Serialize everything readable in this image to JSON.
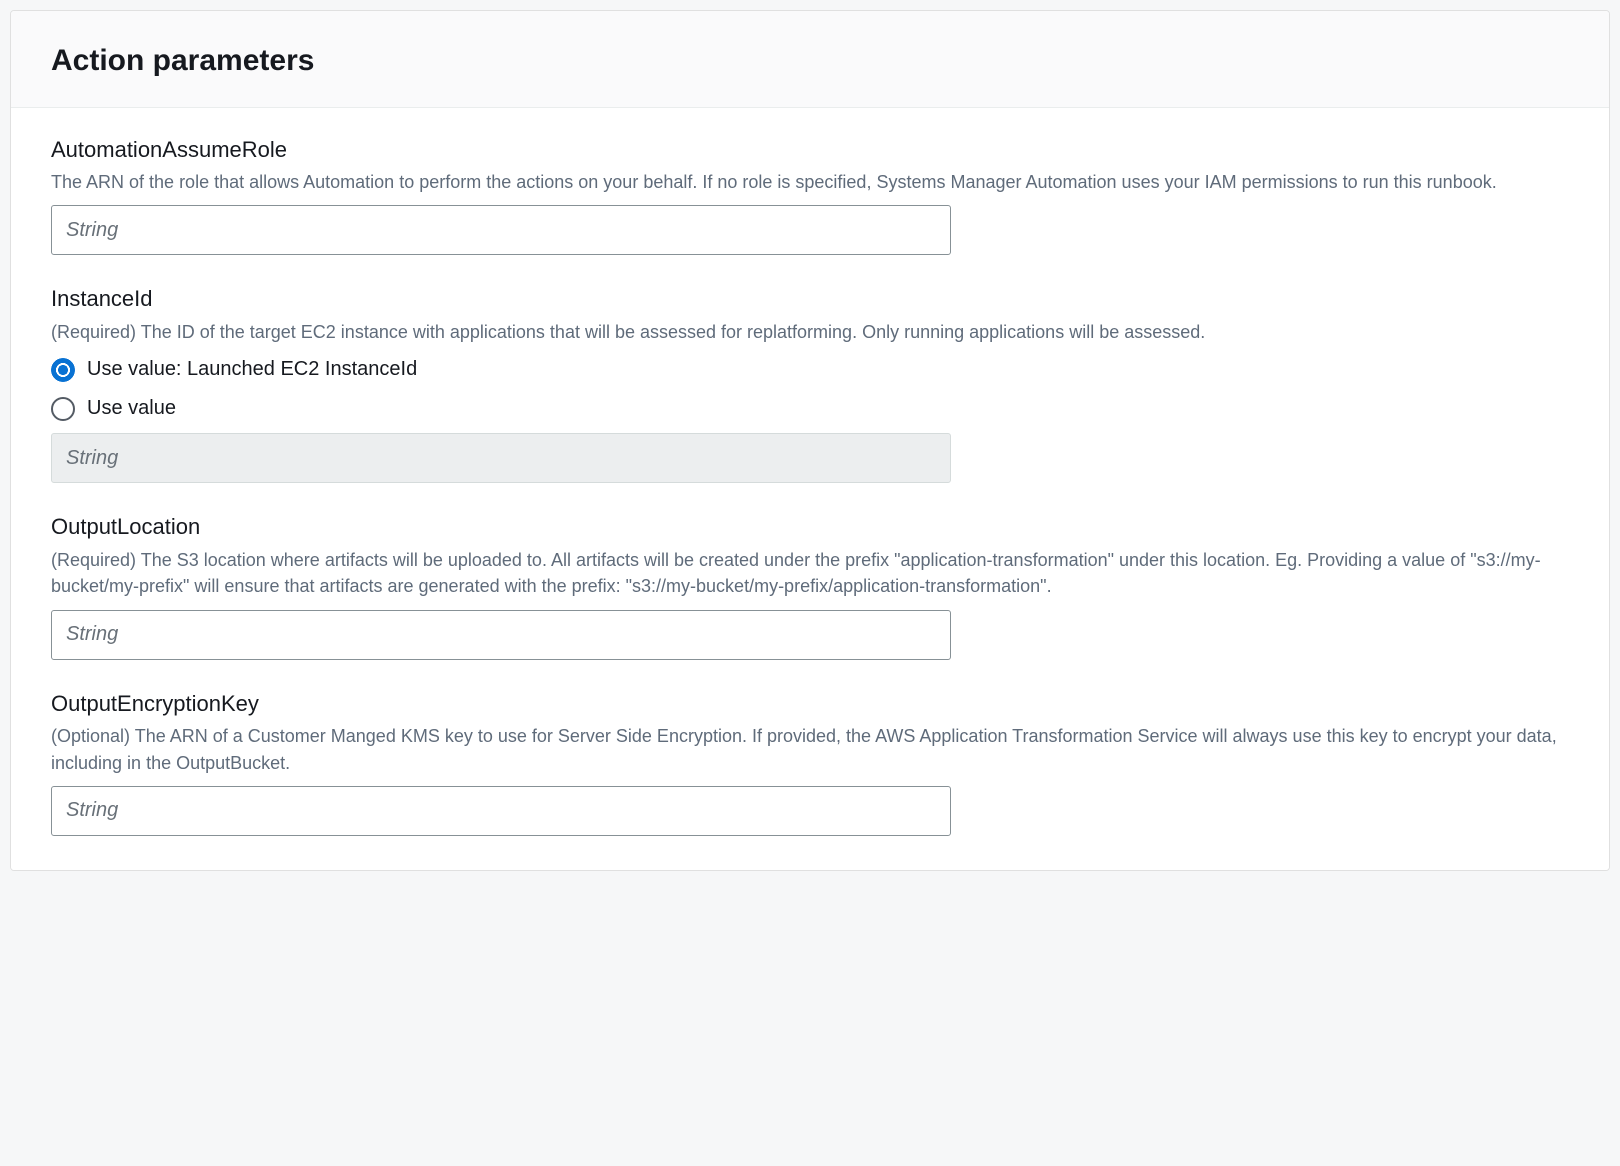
{
  "header": {
    "title": "Action parameters"
  },
  "params": {
    "automationAssumeRole": {
      "name": "AutomationAssumeRole",
      "description": "The ARN of the role that allows Automation to perform the actions on your behalf. If no role is specified, Systems Manager Automation uses your IAM permissions to run this runbook.",
      "placeholder": "String",
      "value": ""
    },
    "instanceId": {
      "name": "InstanceId",
      "description": "(Required) The ID of the target EC2 instance with applications that will be assessed for replatforming. Only running applications will be assessed.",
      "options": [
        {
          "label": "Use value: Launched EC2 InstanceId",
          "selected": true
        },
        {
          "label": "Use value",
          "selected": false
        }
      ],
      "placeholder": "String",
      "value": ""
    },
    "outputLocation": {
      "name": "OutputLocation",
      "description": "(Required) The S3 location where artifacts will be uploaded to. All artifacts will be created under the prefix \"application-transformation\" under this location. Eg. Providing a value of \"s3://my-bucket/my-prefix\" will ensure that artifacts are generated with the prefix: \"s3://my-bucket/my-prefix/application-transformation\".",
      "placeholder": "String",
      "value": ""
    },
    "outputEncryptionKey": {
      "name": "OutputEncryptionKey",
      "description": "(Optional) The ARN of a Customer Manged KMS key to use for Server Side Encryption. If provided, the AWS Application Transformation Service will always use this key to encrypt your data, including in the OutputBucket.",
      "placeholder": "String",
      "value": ""
    }
  }
}
